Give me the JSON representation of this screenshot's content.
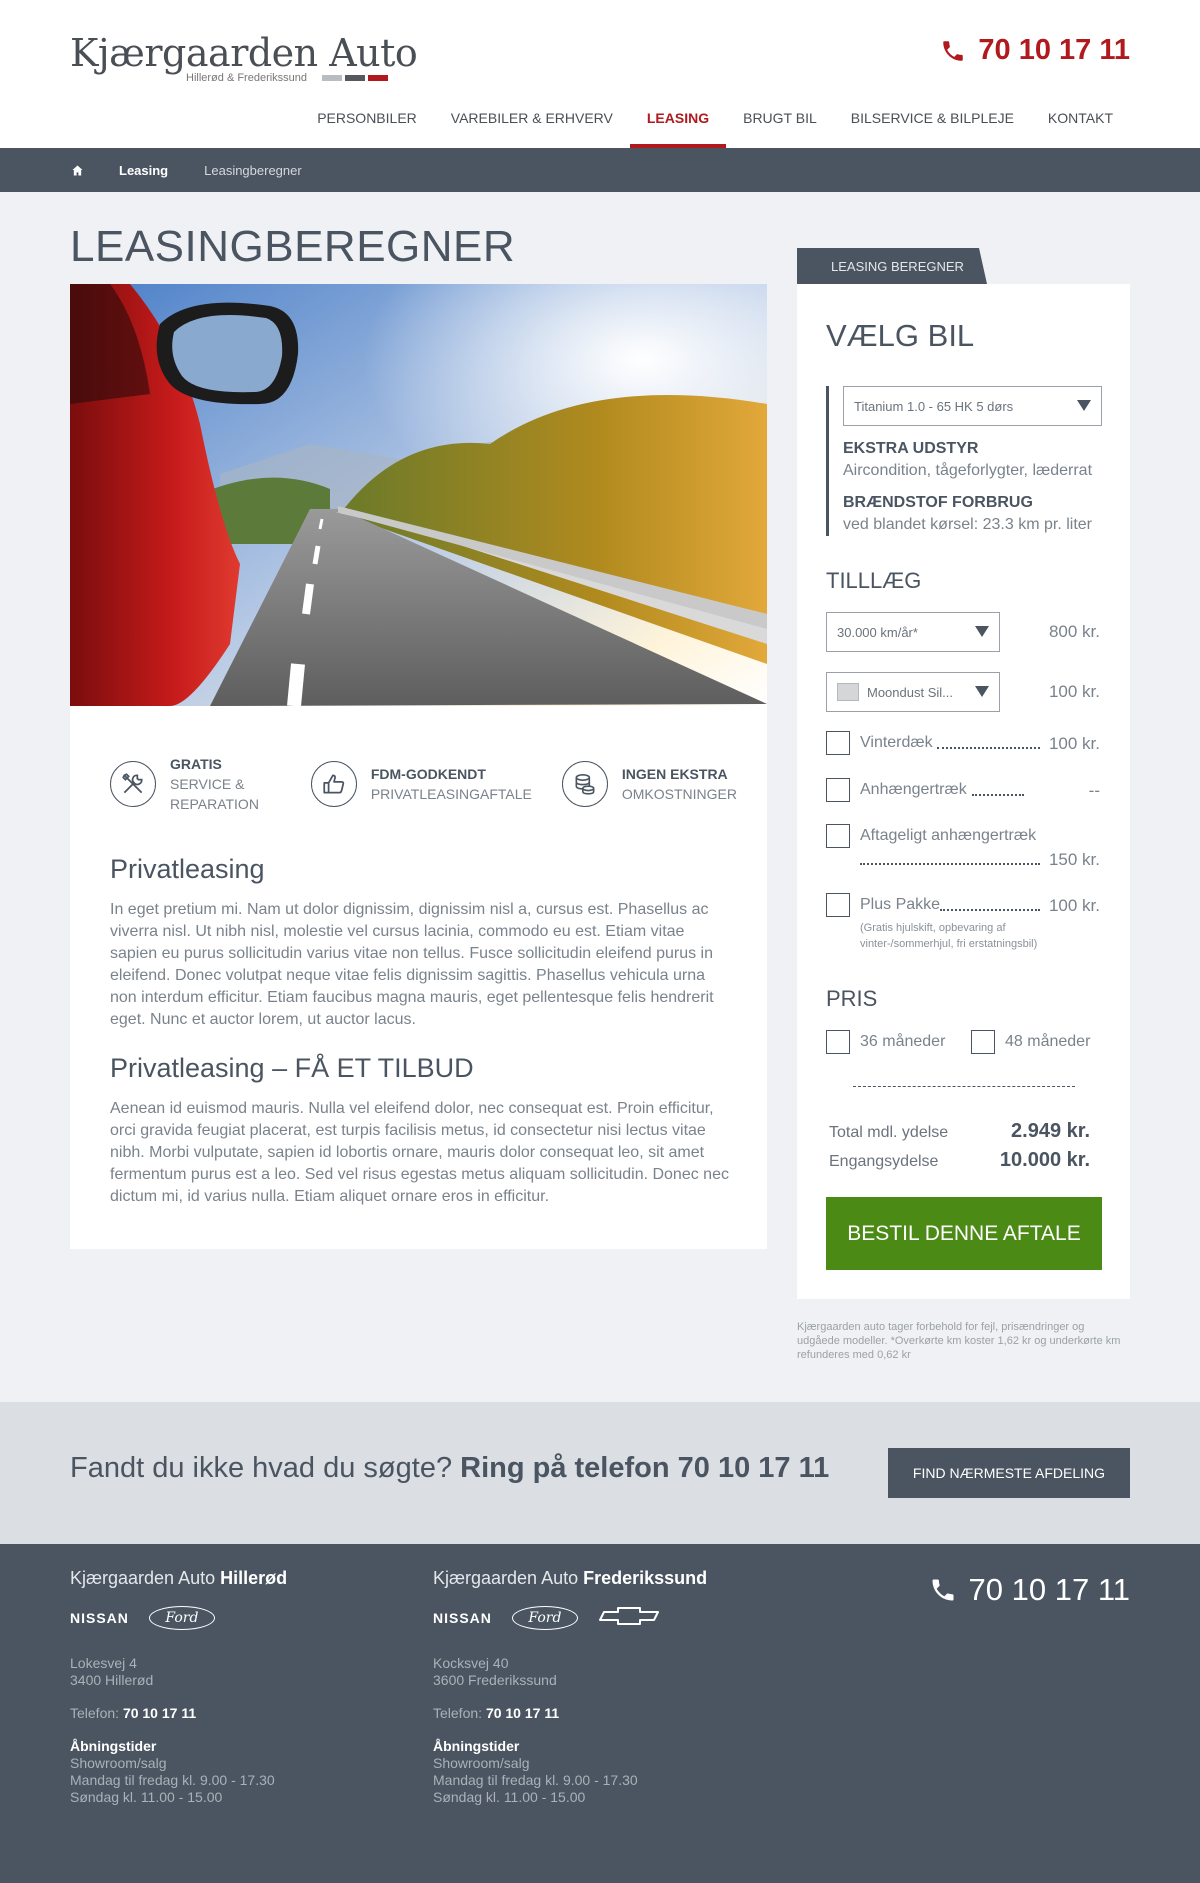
{
  "header": {
    "logo_main": "Kjærgaarden Auto",
    "logo_sub": "Hillerød & Frederikssund",
    "logo_bar_colors": [
      "#b9bcc0",
      "#55595e",
      "#b01a1f"
    ],
    "phone": "70 10 17 11",
    "accent_color": "#b01a1f",
    "phone_icon": "phone-icon"
  },
  "nav": {
    "items": [
      {
        "label": "PERSONBILER"
      },
      {
        "label": "VAREBILER & ERHVERV"
      },
      {
        "label": "LEASING",
        "active": true
      },
      {
        "label": "BRUGT BIL"
      },
      {
        "label": "BILSERVICE & BILPLEJE"
      },
      {
        "label": "KONTAKT"
      }
    ]
  },
  "breadcrumb": {
    "home_icon": "home-icon",
    "items": [
      "Leasing",
      "Leasingberegner"
    ]
  },
  "main": {
    "title": "LEASINGBEREGNER",
    "features": [
      {
        "icon": "tools-icon",
        "title": "GRATIS",
        "sub": "SERVICE & REPARATION"
      },
      {
        "icon": "thumbs-up-icon",
        "title": "FDM-GODKENDT",
        "sub": "PRIVATLEASINGAFTALE"
      },
      {
        "icon": "coins-icon",
        "title": "INGEN EKSTRA",
        "sub": "OMKOSTNINGER"
      }
    ],
    "article": [
      {
        "heading": "Privatleasing",
        "body": "In eget pretium mi. Nam ut dolor dignissim, dignissim nisl a, cursus est. Phasellus ac viverra nisl. Ut nibh nisl, molestie vel cursus lacinia, commodo eu est. Etiam vitae sapien eu purus sollicitudin varius vitae non tellus. Fusce sollicitudin eleifend purus in eleifend. Donec volutpat neque vitae felis dignissim sagittis. Phasellus vehicula urna non interdum efficitur. Etiam faucibus magna mauris, eget pellentesque felis hendrerit eget. Nunc et auctor lorem, ut auctor lacus."
      },
      {
        "heading": "Privatleasing – FÅ ET TILBUD",
        "body": "Aenean id euismod mauris. Nulla vel eleifend dolor, nec consequat est. Proin efficitur, orci gravida feugiat placerat, est turpis facilisis metus, id consectetur nisi lectus vitae nibh. Morbi vulputate, sapien id lobortis ornare, mauris dolor consequat leo, sit amet fermentum purus est a leo. Sed vel risus egestas metus aliquam sollicitudin. Donec nec dictum mi, id varius nulla. Etiam aliquet ornare eros in efficitur."
      }
    ]
  },
  "sidebar": {
    "tab_label": "LEASING BEREGNER",
    "car_heading": "VÆLG BIL",
    "car_select": "Titanium 1.0 - 65 HK 5 dørs",
    "equipment_title": "EKSTRA UDSTYR",
    "equipment_value": "Aircondition, tågeforlygter, læderrat",
    "fuel_title": "BRÆNDSTOF FORBRUG",
    "fuel_value": "ved blandet kørsel: 23.3 km pr. liter",
    "addons_heading": "TILLLÆG",
    "km_select": "30.000 km/år*",
    "km_price": "800 kr.",
    "color_select": "Moondust Sil...",
    "color_swatch": "#d4d6d8",
    "color_price": "100 kr.",
    "options": [
      {
        "label": "Vinterdæk",
        "price": "100 kr."
      },
      {
        "label": "Anhængertræk",
        "price": "--"
      },
      {
        "label": "Aftageligt anhængertræk",
        "price": "150 kr."
      },
      {
        "label": "Plus Pakke",
        "price": "100 kr.",
        "note": "(Gratis hjulskift, opbevaring af vinter-/sommerhjul, fri erstatningsbil)"
      }
    ],
    "price_heading": "PRIS",
    "periods": [
      "36 måneder",
      "48 måneder"
    ],
    "total_label": "Total mdl. ydelse",
    "total_value": "2.949 kr.",
    "once_label": "Engangsydelse",
    "once_value": "10.000 kr.",
    "order_button": "BESTIL DENNE AFTALE",
    "order_color": "#4c8a16",
    "disclaimer": "Kjærgaarden auto tager forbehold for fejl, prisændringer og udgåede modeller. *Overkørte km koster 1,62 kr og underkørte km refunderes med 0,62 kr"
  },
  "cta": {
    "text_plain": "Fandt du ikke hvad du søgte? ",
    "text_bold": "Ring på telefon 70 10 17 11",
    "button": "FIND NÆRMESTE AFDELING"
  },
  "footer": {
    "phone": "70 10 17 11",
    "locations": [
      {
        "title_plain": "Kjærgaarden Auto ",
        "title_bold": "Hillerød",
        "brands": [
          "NISSAN",
          "Ford"
        ],
        "street": "Lokesvej 4",
        "city": "3400 Hillerød",
        "tel_label": "Telefon: ",
        "tel": "70 10 17 11",
        "hours_title": "Åbningstider",
        "hours": [
          "Showroom/salg",
          "Mandag til fredag kl. 9.00 - 17.30",
          "Søndag kl. 11.00 - 15.00"
        ]
      },
      {
        "title_plain": "Kjærgaarden Auto ",
        "title_bold": "Frederikssund",
        "brands": [
          "NISSAN",
          "Ford",
          "chevrolet-icon"
        ],
        "street": "Kocksvej 40",
        "city": "3600 Frederikssund",
        "tel_label": "Telefon: ",
        "tel": "70 10 17 11",
        "hours_title": "Åbningstider",
        "hours": [
          "Showroom/salg",
          "Mandag til fredag kl. 9.00 - 17.30",
          "Søndag kl. 11.00 - 15.00"
        ]
      }
    ]
  }
}
